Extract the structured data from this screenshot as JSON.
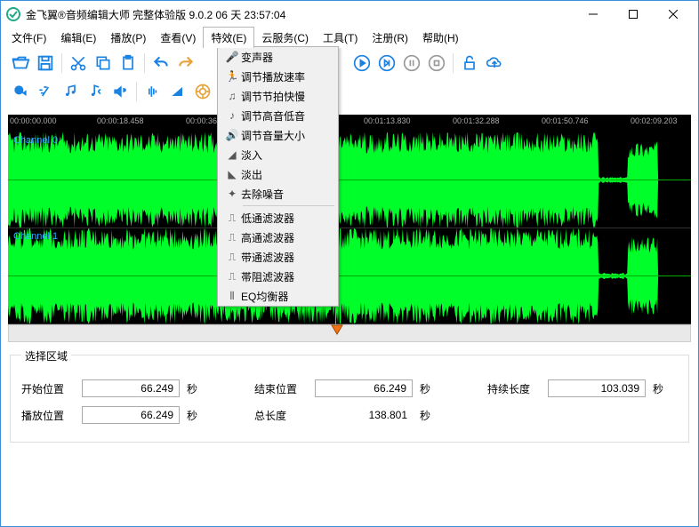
{
  "window": {
    "title": "金飞翼®音频编辑大师 完整体验版 9.0.2 06 天 23:57:04"
  },
  "menus": {
    "file": "文件(F)",
    "edit": "编辑(E)",
    "play": "播放(P)",
    "view": "查看(V)",
    "effect": "特效(E)",
    "cloud": "云服务(C)",
    "tool": "工具(T)",
    "register": "注册(R)",
    "help": "帮助(H)"
  },
  "dropdown": {
    "voice_changer": "变声器",
    "speed": "调节播放速率",
    "tempo": "调节节拍快慢",
    "pitch": "调节高音低音",
    "volume": "调节音量大小",
    "fade_in": "淡入",
    "fade_out": "淡出",
    "denoise": "去除噪音",
    "lowpass": "低通滤波器",
    "highpass": "高通滤波器",
    "bandpass": "带通滤波器",
    "bandstop": "帯阻滤波器",
    "eq": "EQ均衡器"
  },
  "ruler": {
    "t0": "00:00:00.000",
    "t1": "00:00:18.458",
    "t2": "00:00:36.915",
    "t3": "00:01:13.830",
    "t4": "00:01:32.288",
    "t5": "00:01:50.746",
    "t6": "00:02:09.203"
  },
  "channels": {
    "ch0": "Channel 0",
    "ch1": "Channel 1"
  },
  "selection": {
    "legend": "选择区域",
    "start_lbl": "开始位置",
    "start_val": "66.249",
    "sec": "秒",
    "end_lbl": "结束位置",
    "end_val": "66.249",
    "dur_lbl": "持续长度",
    "dur_val": "103.039",
    "play_lbl": "播放位置",
    "play_val": "66.249",
    "total_lbl": "总长度",
    "total_val": "138.801"
  },
  "chart_data": {
    "type": "waveform",
    "channels": 2,
    "duration_sec": 138.801,
    "cursor_sec": 66.249,
    "segments": [
      {
        "start": 0,
        "end": 120,
        "amplitude": 0.85,
        "noise": 0.25
      },
      {
        "start": 120,
        "end": 126,
        "amplitude": 0.05,
        "noise": 0.02
      },
      {
        "start": 126,
        "end": 132,
        "amplitude": 0.7,
        "noise": 0.2
      },
      {
        "start": 132,
        "end": 138.8,
        "amplitude": 0.0,
        "noise": 0.0
      }
    ]
  }
}
